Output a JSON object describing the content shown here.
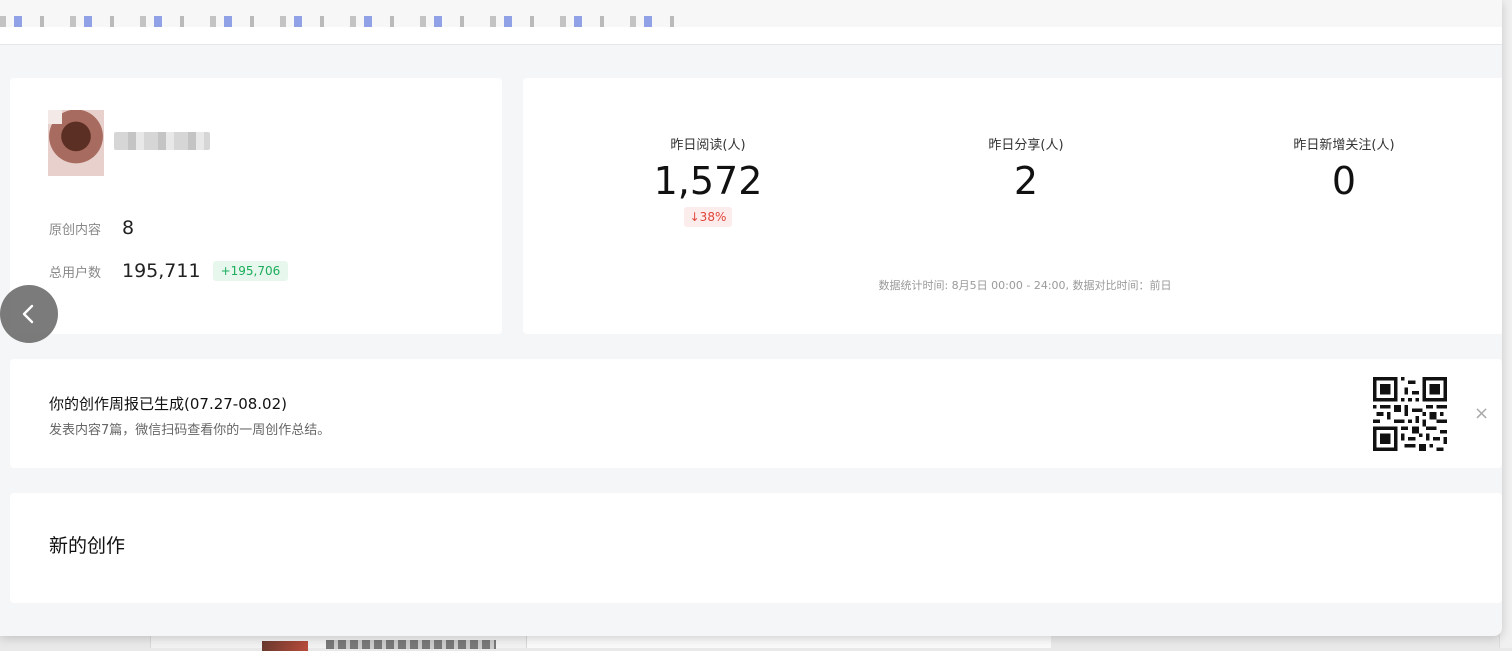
{
  "profile": {
    "original_label": "原创内容",
    "original_value": "8",
    "users_label": "总用户数",
    "users_value": "195,711",
    "users_delta": "+195,706"
  },
  "yesterday": {
    "metrics": [
      {
        "label": "昨日阅读(人)",
        "value": "1,572",
        "change": "↓38%"
      },
      {
        "label": "昨日分享(人)",
        "value": "2"
      },
      {
        "label": "昨日新增关注(人)",
        "value": "0"
      }
    ],
    "note": "数据统计时间: 8月5日 00:00 - 24:00, 数据对比时间：前日"
  },
  "report": {
    "title": "你的创作周报已生成(07.27-08.02)",
    "subtitle": "发表内容7篇，微信扫码查看你的一周创作总结。",
    "close": "×"
  },
  "creation": {
    "title": "新的创作"
  },
  "colors": {
    "positive": "#1aad5a",
    "negative": "#e0443a",
    "background": "#f5f6f7"
  },
  "icons": {
    "back": "chevron-left-icon",
    "close": "close-icon",
    "qr": "qr-code-icon"
  }
}
